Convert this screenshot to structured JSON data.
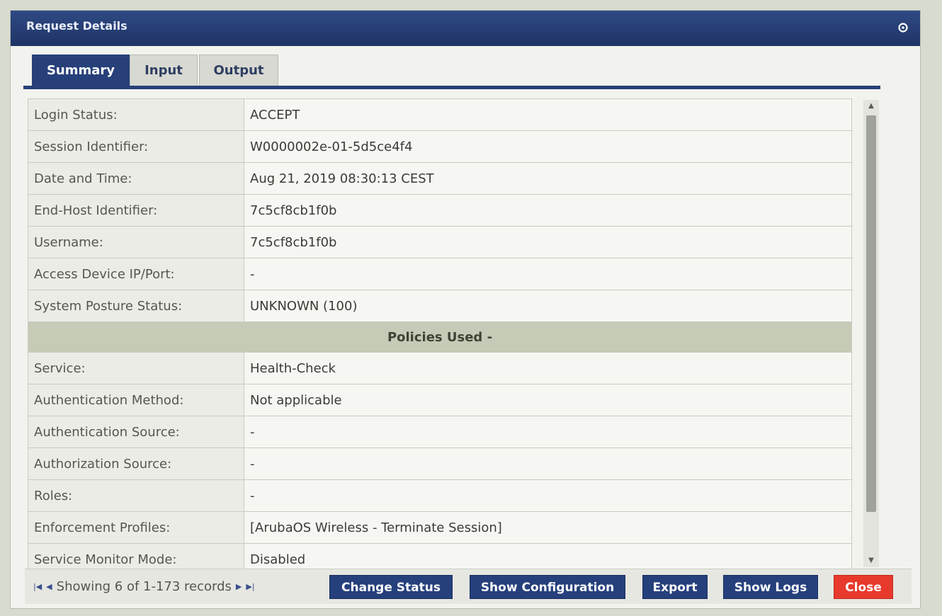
{
  "window": {
    "title": "Request Details",
    "accent_color": "#27407a",
    "close_button_color": "#e83a2c"
  },
  "tabs": [
    {
      "label": "Summary",
      "active": true
    },
    {
      "label": "Input",
      "active": false
    },
    {
      "label": "Output",
      "active": false
    }
  ],
  "summary_rows": [
    {
      "label": "Login Status:",
      "value": "ACCEPT"
    },
    {
      "label": "Session Identifier:",
      "value": "W0000002e-01-5d5ce4f4"
    },
    {
      "label": "Date and Time:",
      "value": "Aug 21, 2019 08:30:13 CEST"
    },
    {
      "label": "End-Host Identifier:",
      "value": "7c5cf8cb1f0b"
    },
    {
      "label": "Username:",
      "value": "7c5cf8cb1f0b"
    },
    {
      "label": "Access Device IP/Port:",
      "value": "-"
    },
    {
      "label": "System Posture Status:",
      "value": "UNKNOWN (100)"
    }
  ],
  "policies_header": "Policies Used -",
  "policy_rows": [
    {
      "label": "Service:",
      "value": "Health-Check"
    },
    {
      "label": "Authentication Method:",
      "value": "Not applicable"
    },
    {
      "label": "Authentication Source:",
      "value": "-"
    },
    {
      "label": "Authorization Source:",
      "value": "-"
    },
    {
      "label": "Roles:",
      "value": "-"
    },
    {
      "label": "Enforcement Profiles:",
      "value": "[ArubaOS Wireless - Terminate Session]"
    },
    {
      "label": "Service Monitor Mode:",
      "value": "Disabled"
    }
  ],
  "footer": {
    "pager_text": "Showing 6 of 1-173 records",
    "buttons": {
      "change_status": "Change Status",
      "show_configuration": "Show Configuration",
      "export": "Export",
      "show_logs": "Show Logs",
      "close": "Close"
    }
  }
}
